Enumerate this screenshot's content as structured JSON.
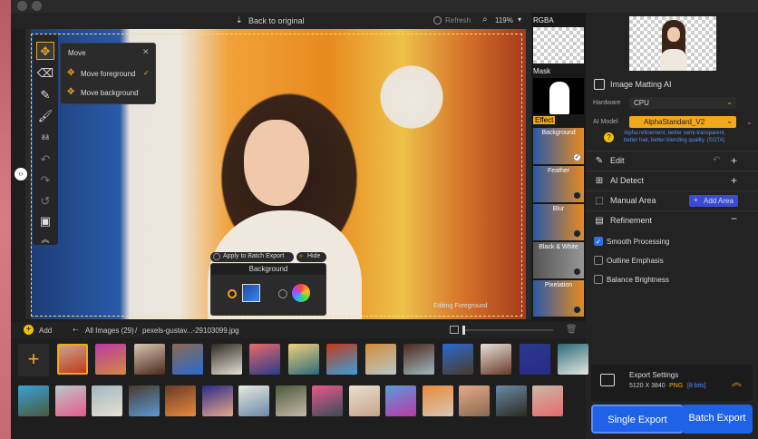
{
  "toolbar": {
    "back_to_original": "Back to original",
    "refresh": "Refresh",
    "zoom": "119%"
  },
  "move_popup": {
    "title": "Move",
    "items": [
      "Move foreground",
      "Move background"
    ]
  },
  "canvas": {
    "apply_batch": "Apply to Batch Export",
    "hide": "Hide",
    "background_title": "Background",
    "editing_label": "Editing Foreground"
  },
  "strip": {
    "rgba": "RGBA",
    "mask": "Mask",
    "effect": "Effect",
    "effects": [
      "Background",
      "Feather",
      "Blur",
      "Black & White",
      "Pixelation"
    ]
  },
  "right": {
    "matting_title": "Image Matting AI",
    "hardware_label": "Hardware",
    "hardware_value": "CPU",
    "model_label": "AI Model",
    "model_value": "AlphaStandard_V2",
    "model_desc": "Alpha refinement, better semi-transparent, better hair, better blending quality. (SOTA)",
    "edit": "Edit",
    "ai_detect": "AI Detect",
    "manual_area": "Manual Area",
    "add_area": "Add Area",
    "refinement": "Refinement",
    "options": [
      {
        "label": "Smooth Processing",
        "checked": true
      },
      {
        "label": "Outline Emphasis",
        "checked": false
      },
      {
        "label": "Balance Brightness",
        "checked": false
      }
    ],
    "export_title": "Export Settings",
    "export_size": "5120 X 3840",
    "export_format": "PNG",
    "export_bits": "[8 bits]",
    "single_export": "Single Export",
    "batch_export": "Batch Export"
  },
  "gallery": {
    "add": "Add",
    "all_images": "All Images (29)",
    "separator": "/",
    "current_file": "pexels-gustav...-29103099.jpg"
  },
  "colors": {
    "accent": "#2e6fe0",
    "highlight": "#f2a81d",
    "blue_btn": "#1f62e8"
  }
}
